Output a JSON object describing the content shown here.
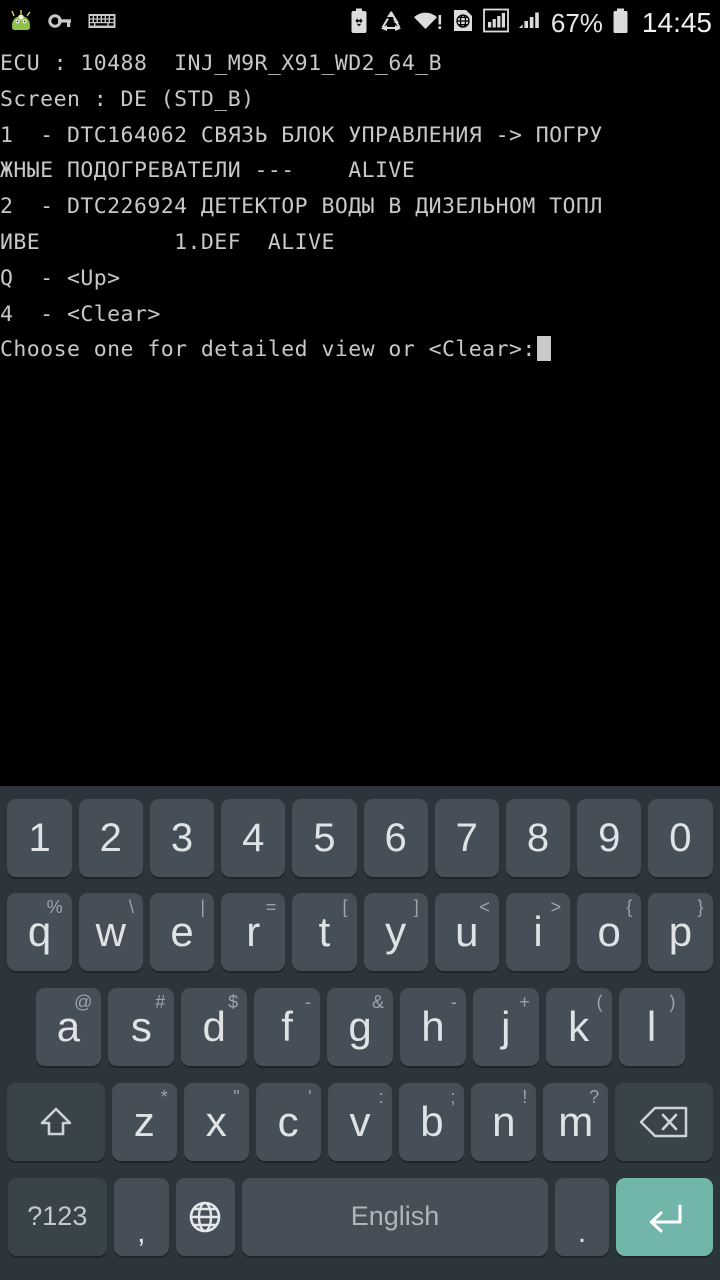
{
  "statusbar": {
    "left_icons": [
      {
        "name": "android-mascot-icon",
        "label": "app"
      },
      {
        "name": "vpn-key-icon",
        "label": "vpn"
      },
      {
        "name": "keyboard-icon",
        "label": "keyboard"
      }
    ],
    "right_icons": [
      {
        "name": "battery-saver-icon",
        "label": "battery saver"
      },
      {
        "name": "data-saver-icon",
        "label": "data saver"
      },
      {
        "name": "wifi-alert-icon",
        "label": "wifi"
      },
      {
        "name": "sim-globe-icon",
        "label": "sim"
      },
      {
        "name": "signal-bars-boxed-icon",
        "label": "signal 1"
      },
      {
        "name": "signal-bars-icon",
        "label": "signal 2"
      }
    ],
    "battery_percent": "67%",
    "battery_icon": "battery-icon",
    "clock": "14:45"
  },
  "terminal": {
    "lines": [
      "ECU : 10488  INJ_M9R_X91_WD2_64_B",
      "Screen : DE (STD_B)",
      "1  - DTC164062 СВЯЗЬ БЛОК УПРАВЛЕНИЯ -> ПОГРУ",
      "ЖНЫЕ ПОДОГРЕВАТЕЛИ ---    ALIVE",
      "2  - DTC226924 ДЕТЕКТОР ВОДЫ В ДИЗЕЛЬНОМ ТОПЛ",
      "ИВЕ          1.DEF  ALIVE",
      "Q  - <Up>",
      "4  - <Clear>"
    ],
    "prompt": "Choose one for detailed view or <Clear>:",
    "text_color": "#c8c8c8",
    "background": "#000000"
  },
  "keyboard": {
    "background": "#2b353b",
    "key_color": "#464f57",
    "enter_color": "#71b5ab",
    "rows": [
      {
        "name": "number-row",
        "keys": [
          {
            "main": "1"
          },
          {
            "main": "2"
          },
          {
            "main": "3"
          },
          {
            "main": "4"
          },
          {
            "main": "5"
          },
          {
            "main": "6"
          },
          {
            "main": "7"
          },
          {
            "main": "8"
          },
          {
            "main": "9"
          },
          {
            "main": "0"
          }
        ]
      },
      {
        "name": "qwerty-row",
        "keys": [
          {
            "main": "q",
            "sup": "%"
          },
          {
            "main": "w",
            "sup": "\\"
          },
          {
            "main": "e",
            "sup": "|"
          },
          {
            "main": "r",
            "sup": "="
          },
          {
            "main": "t",
            "sup": "["
          },
          {
            "main": "y",
            "sup": "]"
          },
          {
            "main": "u",
            "sup": "<"
          },
          {
            "main": "i",
            "sup": ">"
          },
          {
            "main": "o",
            "sup": "{"
          },
          {
            "main": "p",
            "sup": "}"
          }
        ]
      },
      {
        "name": "home-row",
        "keys": [
          {
            "main": "a",
            "sup": "@"
          },
          {
            "main": "s",
            "sup": "#"
          },
          {
            "main": "d",
            "sup": "$"
          },
          {
            "main": "f",
            "sup": "-"
          },
          {
            "main": "g",
            "sup": "&"
          },
          {
            "main": "h",
            "sup": "-"
          },
          {
            "main": "j",
            "sup": "+"
          },
          {
            "main": "k",
            "sup": "("
          },
          {
            "main": "l",
            "sup": ")"
          }
        ]
      },
      {
        "name": "bottom-letter-row",
        "keys": [
          {
            "main": "z",
            "sup": "*"
          },
          {
            "main": "x",
            "sup": "\""
          },
          {
            "main": "c",
            "sup": "'"
          },
          {
            "main": "v",
            "sup": ":"
          },
          {
            "main": "b",
            "sup": ";"
          },
          {
            "main": "n",
            "sup": "!"
          },
          {
            "main": "m",
            "sup": "?"
          }
        ]
      }
    ],
    "shift_key": {
      "name": "shift-key",
      "icon": "shift-arrow-icon"
    },
    "backspace_key": {
      "name": "backspace-key",
      "icon": "backspace-icon"
    },
    "symbol_key": {
      "name": "symbols-key",
      "label": "?123"
    },
    "comma_key": {
      "name": "comma-key",
      "label": ","
    },
    "globe_key": {
      "name": "language-globe-key",
      "icon": "globe-icon"
    },
    "space_key": {
      "name": "space-key",
      "label": "English"
    },
    "period_key": {
      "name": "period-key",
      "label": "."
    },
    "enter_key": {
      "name": "enter-key",
      "icon": "enter-arrow-icon"
    }
  }
}
